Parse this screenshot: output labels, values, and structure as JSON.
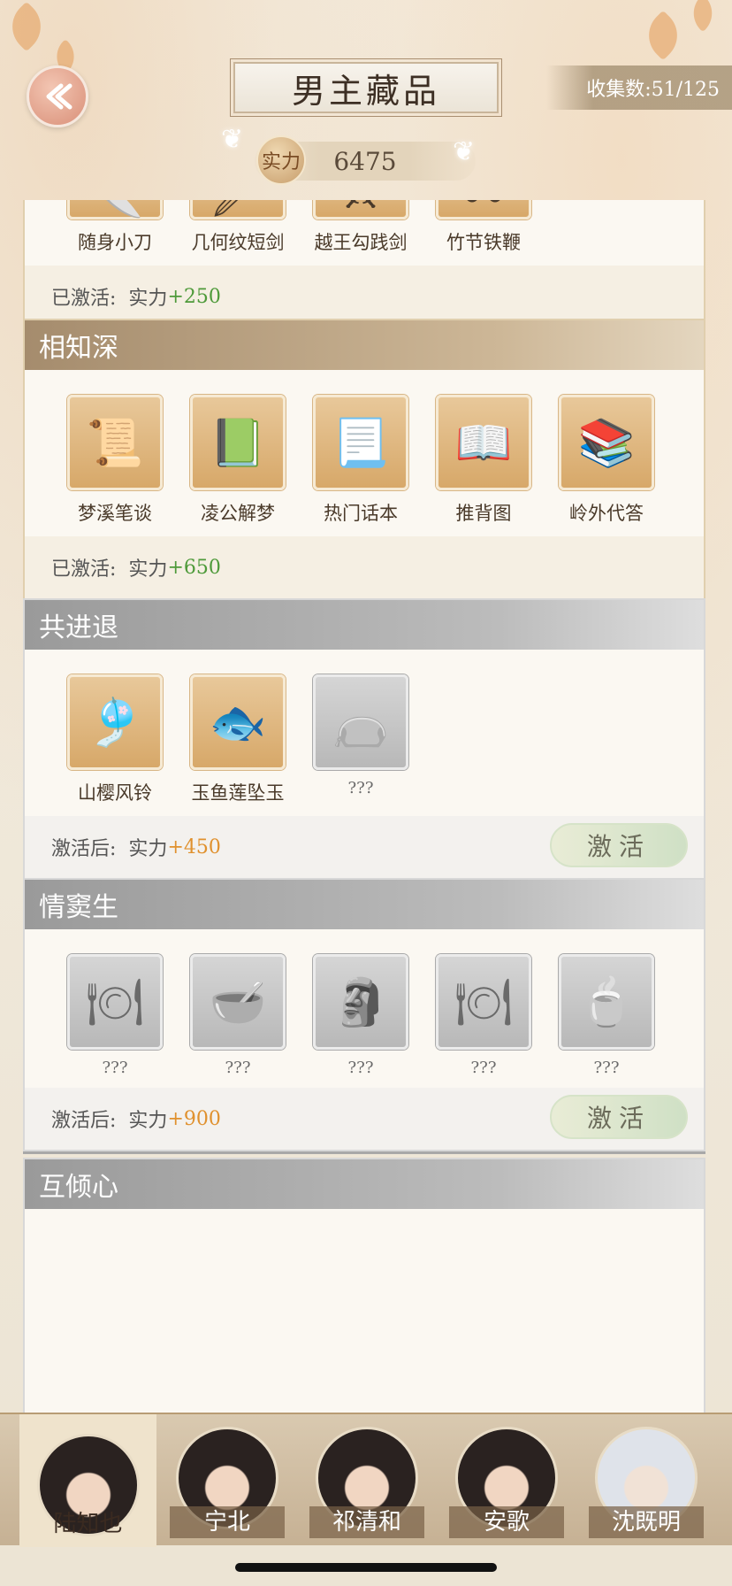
{
  "header": {
    "title": "男主藏品",
    "collect_label": "收集数:51/125",
    "power_badge": "实力",
    "power_value": "6475"
  },
  "sets": [
    {
      "title": "",
      "state": "activated",
      "items": [
        "随身小刀",
        "几何纹短剑",
        "越王勾践剑",
        "竹节铁鞭"
      ],
      "foot_prefix": "已激活:",
      "foot_stat": "实力",
      "foot_bonus": "+250"
    },
    {
      "title": "相知深",
      "state": "activated",
      "items": [
        "梦溪笔谈",
        "凌公解梦",
        "热门话本",
        "推背图",
        "岭外代答"
      ],
      "foot_prefix": "已激活:",
      "foot_stat": "实力",
      "foot_bonus": "+650"
    },
    {
      "title": "共进退",
      "state": "inactive",
      "items": [
        "山樱风铃",
        "玉鱼莲坠玉",
        "???"
      ],
      "foot_prefix": "激活后:",
      "foot_stat": "实力",
      "foot_bonus": "+450",
      "button": "激活"
    },
    {
      "title": "情窦生",
      "state": "inactive",
      "items": [
        "???",
        "???",
        "???",
        "???",
        "???"
      ],
      "foot_prefix": "激活后:",
      "foot_stat": "实力",
      "foot_bonus": "+900",
      "button": "激活"
    },
    {
      "title": "互倾心",
      "state": "inactive"
    }
  ],
  "characters": [
    "陆知也",
    "宁北",
    "祁清和",
    "安歌",
    "沈既明"
  ],
  "colors": {
    "bonus_active": "#4e9a3a",
    "bonus_pending": "#e0912e"
  }
}
